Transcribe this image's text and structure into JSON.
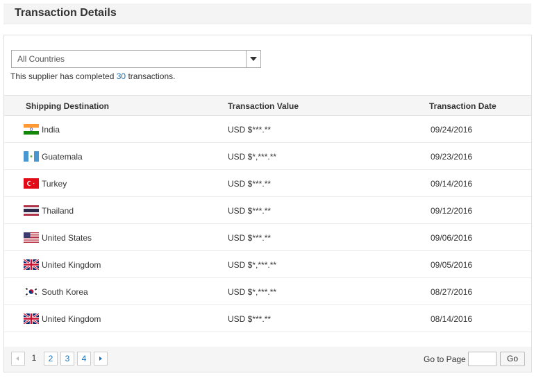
{
  "header": {
    "title": "Transaction Details"
  },
  "filter": {
    "selected": "All Countries"
  },
  "summary": {
    "prefix": "This supplier has completed ",
    "count": "30",
    "suffix": " transactions."
  },
  "columns": {
    "destination": "Shipping Destination",
    "value": "Transaction Value",
    "date": "Transaction Date"
  },
  "rows": [
    {
      "country": "India",
      "flag": "india-flag-icon",
      "value": "USD $***.**",
      "date": "09/24/2016"
    },
    {
      "country": "Guatemala",
      "flag": "guatemala-flag-icon",
      "value": "USD $*,***.**",
      "date": "09/23/2016"
    },
    {
      "country": "Turkey",
      "flag": "turkey-flag-icon",
      "value": "USD $***.**",
      "date": "09/14/2016"
    },
    {
      "country": "Thailand",
      "flag": "thailand-flag-icon",
      "value": "USD $***.**",
      "date": "09/12/2016"
    },
    {
      "country": "United States",
      "flag": "united-states-flag-icon",
      "value": "USD $***.**",
      "date": "09/06/2016"
    },
    {
      "country": "United Kingdom",
      "flag": "united-kingdom-flag-icon",
      "value": "USD $*,***.**",
      "date": "09/05/2016"
    },
    {
      "country": "South Korea",
      "flag": "south-korea-flag-icon",
      "value": "USD $*,***.**",
      "date": "08/27/2016"
    },
    {
      "country": "United Kingdom",
      "flag": "united-kingdom-flag-icon",
      "value": "USD $***.**",
      "date": "08/14/2016"
    }
  ],
  "pagination": {
    "current": "1",
    "pages": [
      "2",
      "3",
      "4"
    ],
    "goto_label": "Go to Page",
    "goto_value": "",
    "go_label": "Go"
  },
  "colors": {
    "link": "#1a6fb8",
    "header_bg": "#f4f4f4"
  }
}
